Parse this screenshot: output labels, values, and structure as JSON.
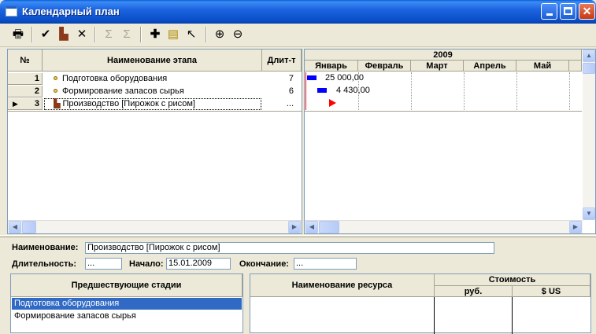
{
  "window": {
    "title": "Календарный план"
  },
  "stages_table": {
    "columns": [
      "№",
      "Наименование этапа",
      "Длит-т"
    ],
    "rows": [
      {
        "num": "1",
        "name": "Подготовка оборудования",
        "duration": "7"
      },
      {
        "num": "2",
        "name": "Формирование запасов сырья",
        "duration": "6"
      },
      {
        "num": "3",
        "name": "Производство [Пирожок с рисом]",
        "duration": "..."
      }
    ],
    "selected_row": 3
  },
  "gantt": {
    "year": "2009",
    "months": [
      "Январь",
      "Февраль",
      "Март",
      "Апрель",
      "Май"
    ],
    "bar_labels": [
      "25 000,00",
      "4 430,00"
    ]
  },
  "details": {
    "name_label": "Наименование:",
    "name_value": "Производство [Пирожок с рисом]",
    "duration_label": "Длительность:",
    "duration_value": "...",
    "start_label": "Начало:",
    "start_value": "15.01.2009",
    "end_label": "Окончание:",
    "end_value": "..."
  },
  "predecessors": {
    "header": "Предшествующие стадии",
    "items": [
      "Подготовка оборудования",
      "Формирование запасов сырья"
    ],
    "selected_index": 0
  },
  "resources": {
    "name_header": "Наименование ресурса",
    "cost_header": "Стоимость",
    "rub_header": "руб.",
    "usd_header": "$ US"
  },
  "colors": {
    "titlebar": "#0a4fc9",
    "selection": "#316ac5",
    "bar": "#0000ff",
    "milestone": "#ff0000"
  },
  "icons": [
    "print-icon",
    "check-icon",
    "factory-icon",
    "delete-icon",
    "sum-icon",
    "sum-icon",
    "add-icon",
    "tree-icon",
    "pointer-icon",
    "zoom-in-icon",
    "zoom-out-icon"
  ]
}
